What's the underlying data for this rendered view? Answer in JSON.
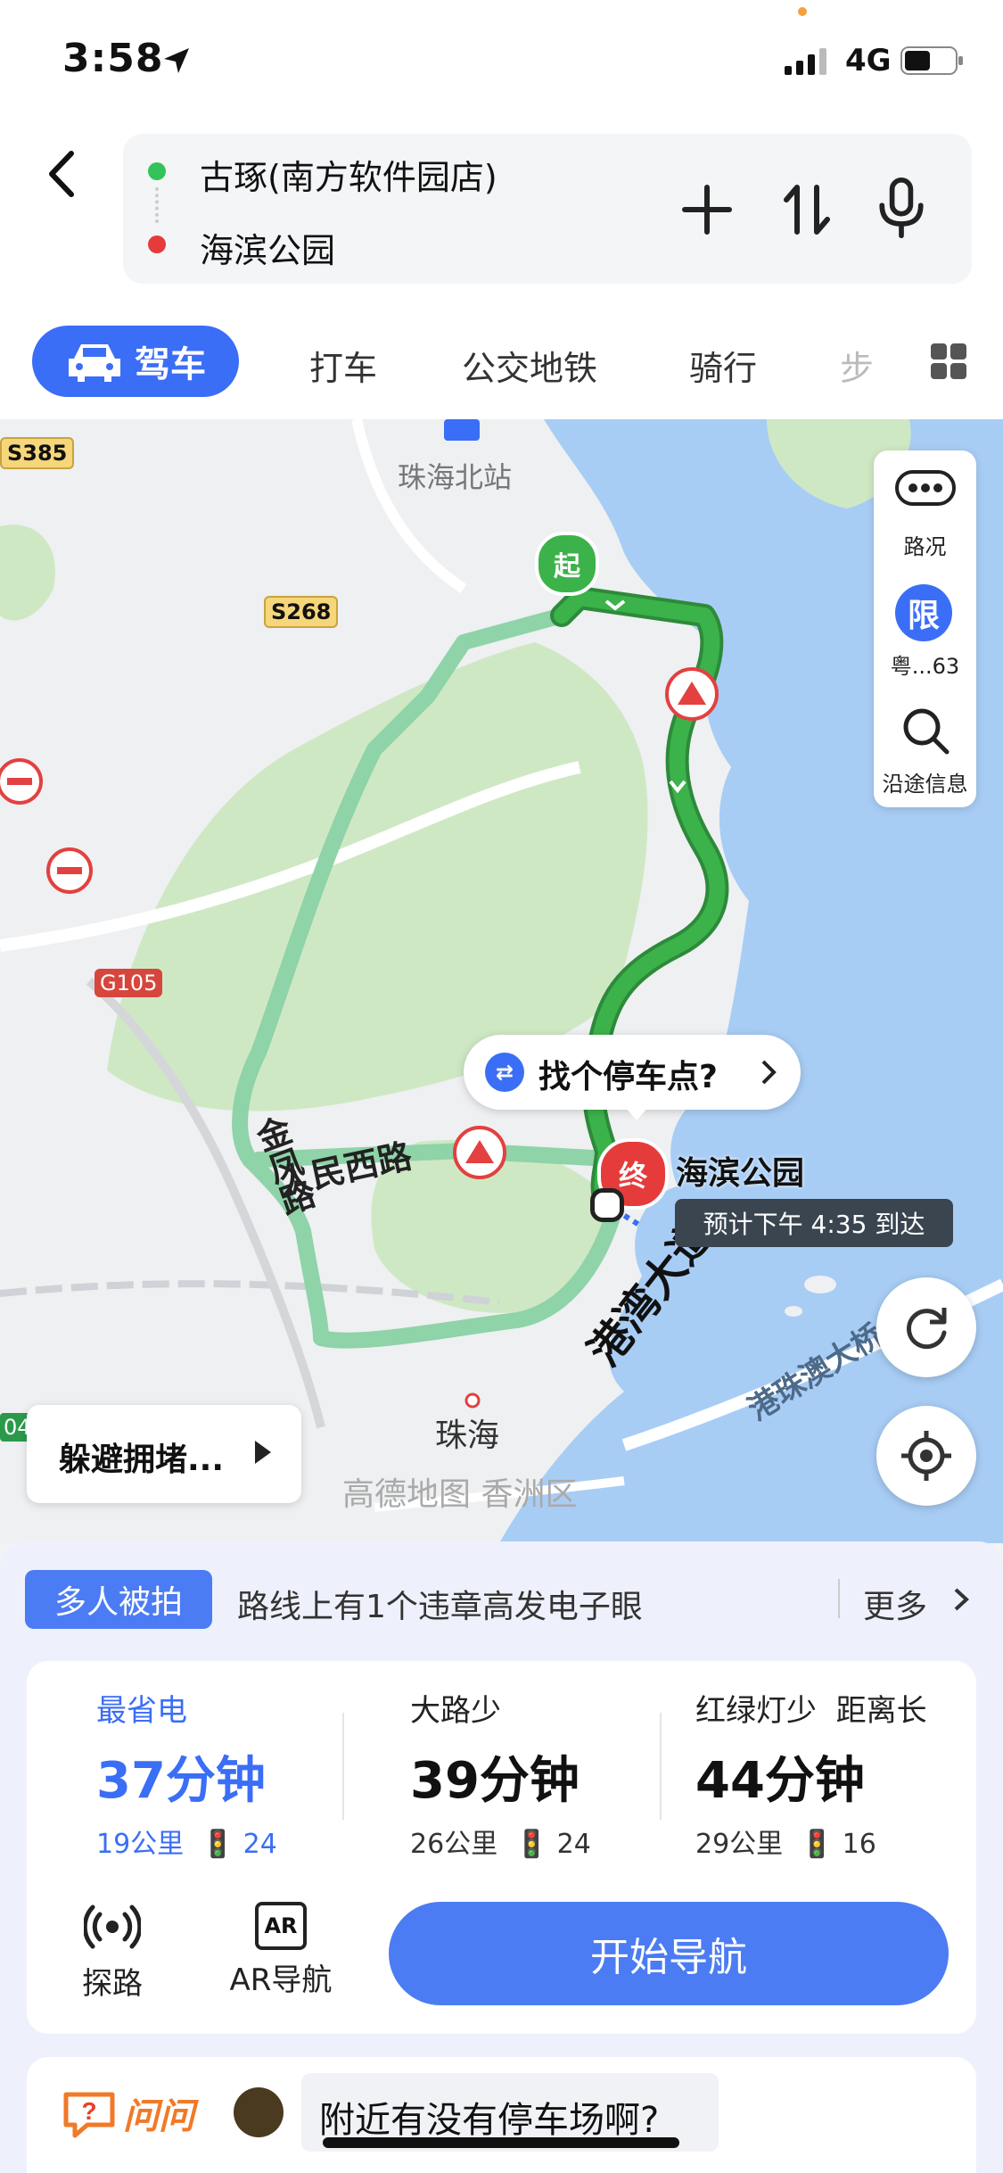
{
  "status_bar": {
    "time": "3:58",
    "network": "4G"
  },
  "header": {
    "origin": "古琢(南方软件园店)",
    "destination": "海滨公园"
  },
  "tabs": {
    "drive": "驾车",
    "taxi": "打车",
    "transit": "公交地铁",
    "bike": "骑行",
    "walk": "步"
  },
  "map_ctrl": {
    "traffic": "路况",
    "limit_badge": "限",
    "limit_plate": "粤...63",
    "along_info": "沿途信息"
  },
  "map": {
    "labels": {
      "zhuhai_north": "珠海北站",
      "s385": "S385",
      "s268": "S268",
      "g105": "G105",
      "jinfeng": "金凤路",
      "renmin": "人民西路",
      "gangwan": "港湾大道",
      "zhuhai": "珠海",
      "hzmb": "港珠澳大桥",
      "watermark": "高德地图 香洲区",
      "edge_num": "04"
    },
    "start_marker": "起",
    "end_marker": "终",
    "dest_label": "海滨公园",
    "eta": "预计下午 4:35 到达",
    "parking": "找个停车点?",
    "avoid": "躲避拥堵..."
  },
  "notice": {
    "badge": "多人被拍",
    "text": "路线上有1个违章高发电子眼",
    "more": "更多"
  },
  "routes": [
    {
      "tag": "最省电",
      "time": "37分钟",
      "distance": "19公里",
      "lights": "24",
      "selected": true
    },
    {
      "tag": "大路少",
      "time": "39分钟",
      "distance": "26公里",
      "lights": "24",
      "selected": false
    },
    {
      "tag": "红绿灯少  距离长",
      "time": "44分钟",
      "distance": "29公里",
      "lights": "16",
      "selected": false
    }
  ],
  "actions": {
    "explore": "探路",
    "ar_nav": "AR导航",
    "ar_icon": "AR",
    "start": "开始导航"
  },
  "ask": {
    "label": "问问",
    "question": "附近有没有停车场啊?"
  },
  "colors": {
    "accent": "#3b6ef6",
    "route_selected": "#3cb24a",
    "route_alt": "#8fd3a8",
    "water": "#a8cdf5",
    "land": "#eef0f2",
    "park": "#cfe8c4"
  }
}
